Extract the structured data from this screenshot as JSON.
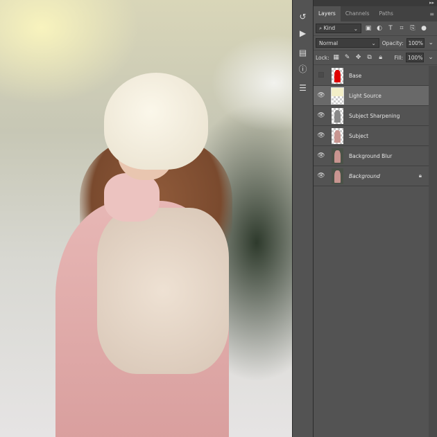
{
  "panel": {
    "tabs": [
      "Layers",
      "Channels",
      "Paths"
    ],
    "active_tab": "Layers",
    "filter_kind": "Kind",
    "blend_mode": "Normal",
    "opacity_label": "Opacity:",
    "opacity": "100%",
    "lock_label": "Lock:",
    "fill_label": "Fill:",
    "fill": "100%"
  },
  "layers": [
    {
      "name": "Base",
      "visible": false,
      "thumb_color": "#e00000"
    },
    {
      "name": "Light Source",
      "visible": true,
      "thumb_color": "#f3efc8",
      "active": true
    },
    {
      "name": "Subject Sharpening",
      "visible": true,
      "thumb_color": "#888888"
    },
    {
      "name": "Subject",
      "visible": true,
      "thumb_color": "#c89590"
    },
    {
      "name": "Background Blur",
      "visible": true,
      "thumb_color": "#7a6a60"
    },
    {
      "name": "Background",
      "visible": true,
      "thumb_color": "#7a6a60",
      "locked": true
    }
  ]
}
